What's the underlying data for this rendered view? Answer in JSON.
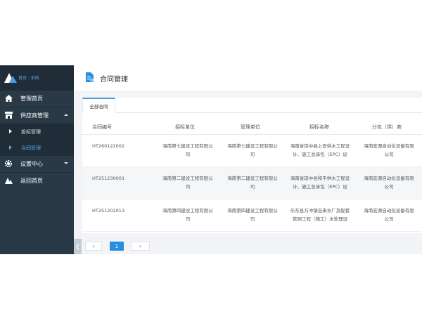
{
  "sidebar": {
    "brand": "首页 · 系统",
    "items": [
      {
        "label": "管理首页",
        "icon": "home-icon"
      },
      {
        "label": "供应商管理",
        "icon": "store-icon"
      },
      {
        "label": "投标管理",
        "icon": "caret-right-icon"
      },
      {
        "label": "合同管理",
        "icon": "caret-right-icon"
      },
      {
        "label": "设置中心",
        "icon": "gear-icon"
      },
      {
        "label": "返回首页",
        "icon": "logo-icon"
      }
    ]
  },
  "header": {
    "title": "合同管理"
  },
  "tabs": [
    {
      "label": "全部合同"
    }
  ],
  "table": {
    "columns": [
      "合同编号",
      "招标单位",
      "管理单位",
      "招标名称",
      "分包（供）商"
    ],
    "rows": [
      {
        "code": "HT260122002",
        "unit": [
          "海南第七建设工程有限公",
          "司"
        ],
        "mgmt": [
          "海南第七建设工程有限公",
          "司"
        ],
        "name": [
          "海南省琼中县上安供水工程设",
          "计、施工总承包（EPC）设"
        ],
        "sub": [
          "海南宏源自动化设备有限",
          "公司"
        ]
      },
      {
        "code": "HT251230001",
        "unit": [
          "海南第二建设工程有限公",
          "司"
        ],
        "mgmt": [
          "海南第二建设工程有限公",
          "司"
        ],
        "name": [
          "海南省琼中县和平供水工程设",
          "计、施工总承包（EPC）设"
        ],
        "sub": [
          "海南宏源自动化设备有限",
          "公司"
        ]
      },
      {
        "code": "HT251202013",
        "unit": [
          "海南第四建设工程有限公",
          "司"
        ],
        "mgmt": [
          "海南第四建设工程有限公",
          "司"
        ],
        "name": [
          "乐东县万冲镇自来水厂及配套",
          "管网工程（施工）水处理设"
        ],
        "sub": [
          "海南宏源自动化设备有限",
          "公司"
        ]
      }
    ]
  },
  "pagination": {
    "prev": "‹",
    "current": "1",
    "next": "›"
  },
  "colors": {
    "sidebar": "#2a3946",
    "accent": "#2a8ee0",
    "active_text": "#5aa6e6"
  }
}
